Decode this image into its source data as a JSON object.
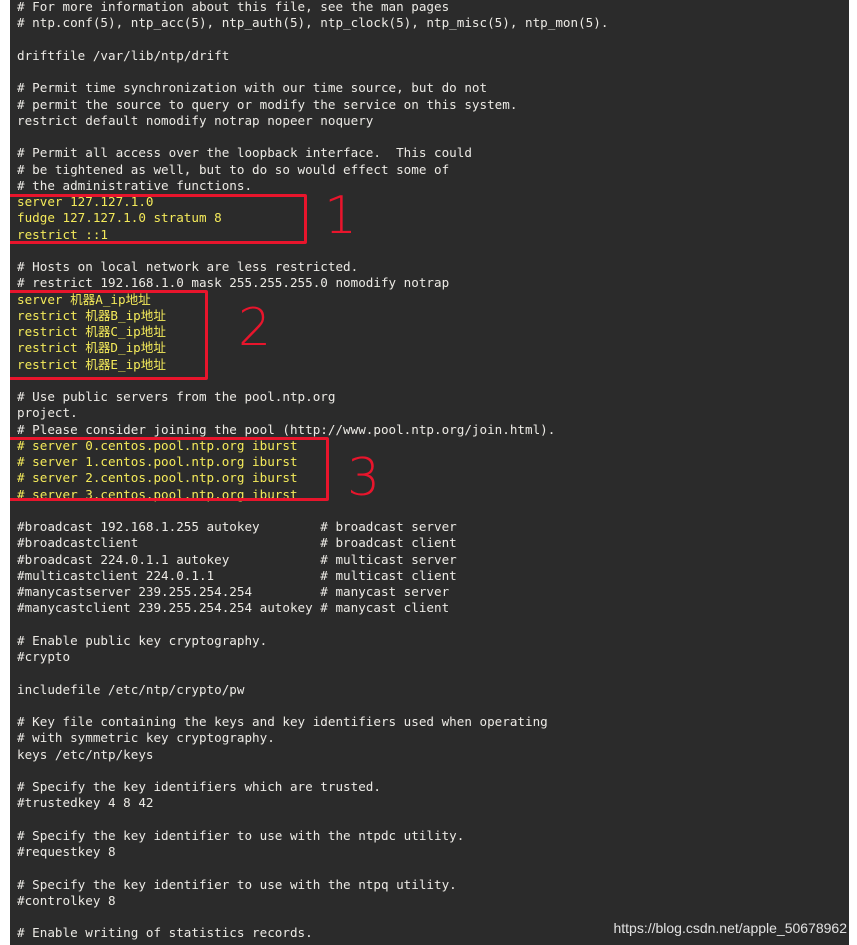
{
  "lines": [
    {
      "text": "# For more information about this file, see the man pages",
      "hl": false
    },
    {
      "text": "# ntp.conf(5), ntp_acc(5), ntp_auth(5), ntp_clock(5), ntp_misc(5), ntp_mon(5).",
      "hl": false
    },
    {
      "text": "",
      "hl": false
    },
    {
      "text": "driftfile /var/lib/ntp/drift",
      "hl": false
    },
    {
      "text": "",
      "hl": false
    },
    {
      "text": "# Permit time synchronization with our time source, but do not",
      "hl": false
    },
    {
      "text": "# permit the source to query or modify the service on this system.",
      "hl": false
    },
    {
      "text": "restrict default nomodify notrap nopeer noquery",
      "hl": false
    },
    {
      "text": "",
      "hl": false
    },
    {
      "text": "# Permit all access over the loopback interface.  This could",
      "hl": false
    },
    {
      "text": "# be tightened as well, but to do so would effect some of",
      "hl": false
    },
    {
      "text": "# the administrative functions.",
      "hl": false
    },
    {
      "text": "server 127.127.1.0",
      "hl": true
    },
    {
      "text": "fudge 127.127.1.0 stratum 8",
      "hl": true
    },
    {
      "text": "restrict ::1",
      "hl": true
    },
    {
      "text": "",
      "hl": false
    },
    {
      "text": "# Hosts on local network are less restricted.",
      "hl": false
    },
    {
      "text": "# restrict 192.168.1.0 mask 255.255.255.0 nomodify notrap",
      "hl": false
    },
    {
      "text": "server 机器A_ip地址",
      "hl": true
    },
    {
      "text": "restrict 机器B_ip地址",
      "hl": true
    },
    {
      "text": "restrict 机器C_ip地址",
      "hl": true
    },
    {
      "text": "restrict 机器D_ip地址",
      "hl": true
    },
    {
      "text": "restrict 机器E_ip地址",
      "hl": true
    },
    {
      "text": "",
      "hl": false
    },
    {
      "text": "# Use public servers from the pool.ntp.org",
      "hl": false
    },
    {
      "text": "project.",
      "hl": false
    },
    {
      "text": "# Please consider joining the pool (http://www.pool.ntp.org/join.html).",
      "hl": false
    },
    {
      "text": "# server 0.centos.pool.ntp.org iburst",
      "hl": true
    },
    {
      "text": "# server 1.centos.pool.ntp.org iburst",
      "hl": true
    },
    {
      "text": "# server 2.centos.pool.ntp.org iburst",
      "hl": true
    },
    {
      "text": "# server 3.centos.pool.ntp.org iburst",
      "hl": true
    },
    {
      "text": "",
      "hl": false
    },
    {
      "text": "#broadcast 192.168.1.255 autokey        # broadcast server",
      "hl": false
    },
    {
      "text": "#broadcastclient                        # broadcast client",
      "hl": false
    },
    {
      "text": "#broadcast 224.0.1.1 autokey            # multicast server",
      "hl": false
    },
    {
      "text": "#multicastclient 224.0.1.1              # multicast client",
      "hl": false
    },
    {
      "text": "#manycastserver 239.255.254.254         # manycast server",
      "hl": false
    },
    {
      "text": "#manycastclient 239.255.254.254 autokey # manycast client",
      "hl": false
    },
    {
      "text": "",
      "hl": false
    },
    {
      "text": "# Enable public key cryptography.",
      "hl": false
    },
    {
      "text": "#crypto",
      "hl": false
    },
    {
      "text": "",
      "hl": false
    },
    {
      "text": "includefile /etc/ntp/crypto/pw",
      "hl": false
    },
    {
      "text": "",
      "hl": false
    },
    {
      "text": "# Key file containing the keys and key identifiers used when operating",
      "hl": false
    },
    {
      "text": "# with symmetric key cryptography.",
      "hl": false
    },
    {
      "text": "keys /etc/ntp/keys",
      "hl": false
    },
    {
      "text": "",
      "hl": false
    },
    {
      "text": "# Specify the key identifiers which are trusted.",
      "hl": false
    },
    {
      "text": "#trustedkey 4 8 42",
      "hl": false
    },
    {
      "text": "",
      "hl": false
    },
    {
      "text": "# Specify the key identifier to use with the ntpdc utility.",
      "hl": false
    },
    {
      "text": "#requestkey 8",
      "hl": false
    },
    {
      "text": "",
      "hl": false
    },
    {
      "text": "# Specify the key identifier to use with the ntpq utility.",
      "hl": false
    },
    {
      "text": "#controlkey 8",
      "hl": false
    },
    {
      "text": "",
      "hl": false
    },
    {
      "text": "# Enable writing of statistics records.",
      "hl": false
    }
  ],
  "annotations": {
    "label1": "1",
    "label2": "2",
    "label3": "3"
  },
  "watermark": "https://blog.csdn.net/apple_50678962",
  "colors": {
    "background": "#2b2b2b",
    "text": "#eceae5",
    "highlight": "#f4ea5a",
    "annotation": "#e8152c"
  }
}
